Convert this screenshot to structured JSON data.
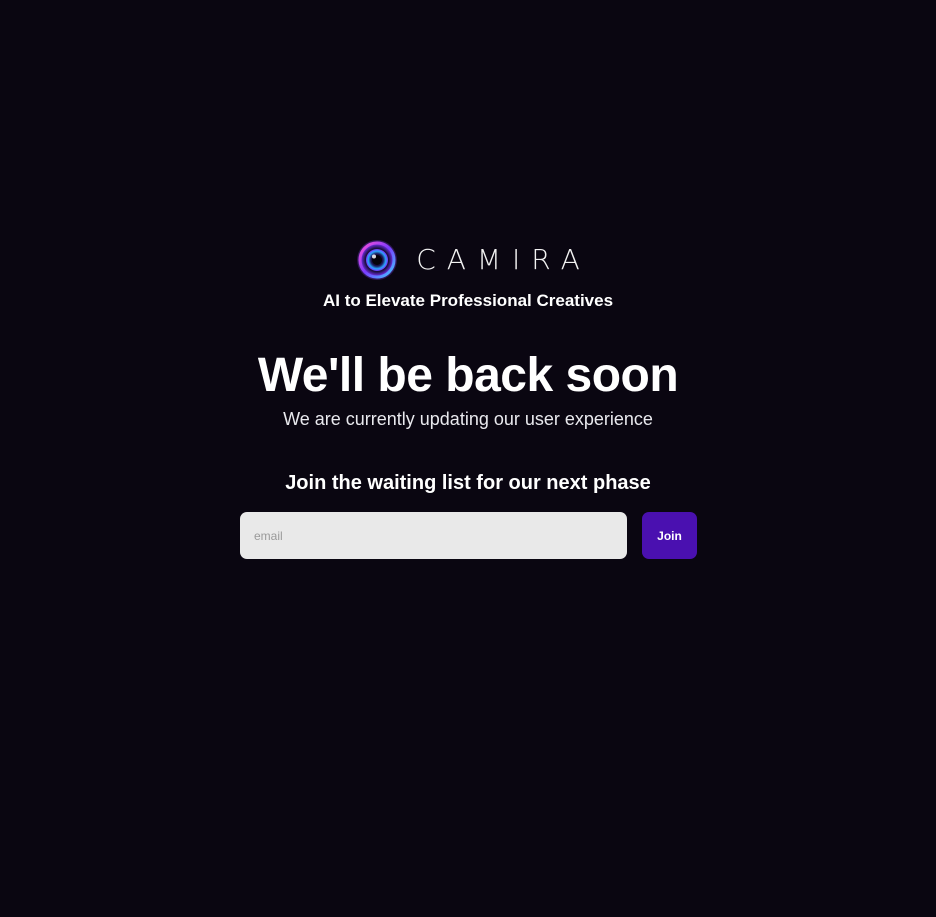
{
  "brand": {
    "name": "CAMIRA",
    "tagline": "AI to Elevate Professional Creatives",
    "logo_icon": "camera-lens-icon"
  },
  "hero": {
    "headline": "We'll be back soon",
    "subheadline": "We are currently updating our user experience"
  },
  "waitlist": {
    "heading": "Join the waiting list for our next phase",
    "email_placeholder": "email",
    "email_value": "",
    "join_label": "Join"
  },
  "colors": {
    "background": "#0a0611",
    "input_background": "#e9e9e9",
    "button_accent": "#4a10b0",
    "text": "#ffffff"
  }
}
